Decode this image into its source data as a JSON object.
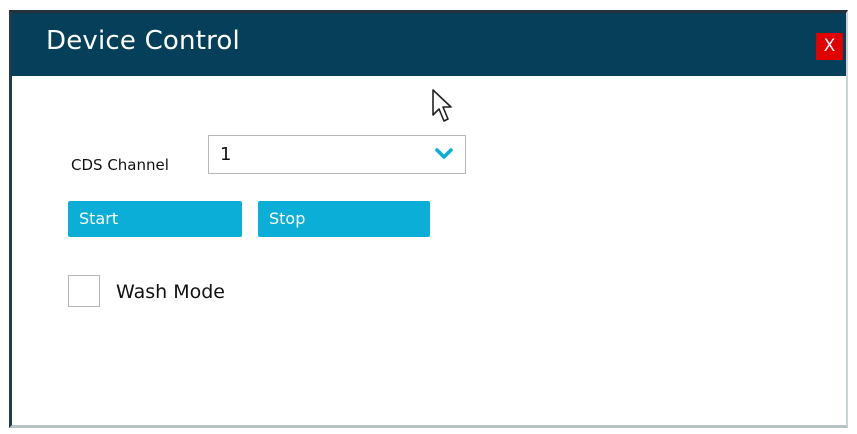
{
  "window": {
    "title": "Device Control",
    "close_label": "X"
  },
  "channel": {
    "label": "CDS Channel",
    "selected_value": "1"
  },
  "buttons": {
    "start_label": "Start",
    "stop_label": "Stop"
  },
  "wash_mode": {
    "label": "Wash Mode",
    "checked": false
  },
  "colors": {
    "titlebar": "#063f5a",
    "accent": "#0baed6",
    "close": "#e00000"
  },
  "icons": {
    "cursor": "arrow-cursor-icon",
    "dropdown": "chevron-down-icon"
  }
}
